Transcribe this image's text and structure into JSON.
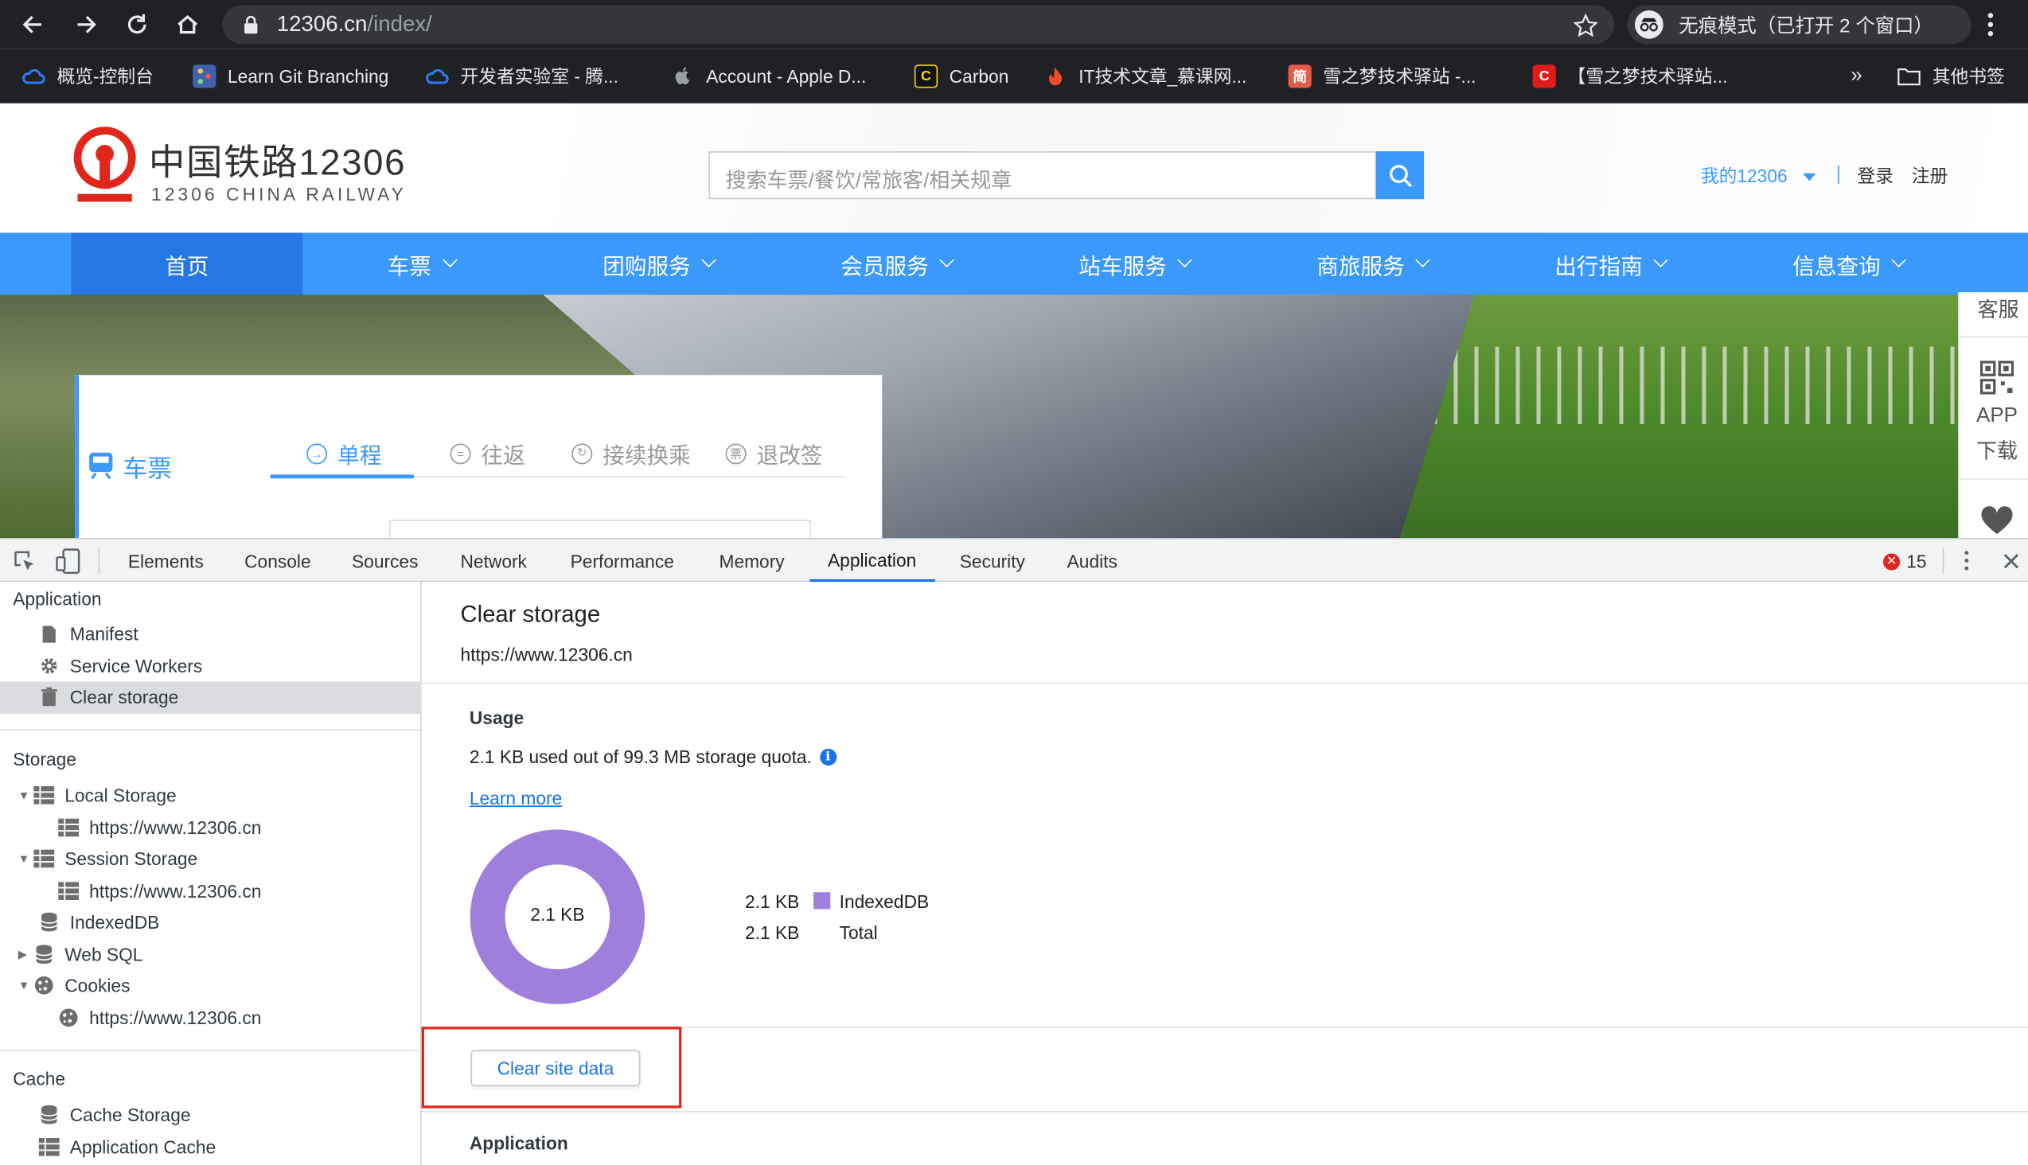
{
  "browser": {
    "url_host": "12306.cn",
    "url_path": "/index/",
    "incognito_label": "无痕模式（已打开 2 个窗口）",
    "bookmarks": [
      {
        "label": "概览-控制台",
        "icon": "cloud-icon",
        "color": "#2a7df7"
      },
      {
        "label": "Learn Git Branching",
        "icon": "git-branching-icon",
        "color": "#3f64ad"
      },
      {
        "label": "开发者实验室 - 腾...",
        "icon": "cloud-icon",
        "color": "#2a7df7"
      },
      {
        "label": "Account - Apple D...",
        "icon": "apple-icon",
        "color": "#9aa0a6"
      },
      {
        "label": "Carbon",
        "icon": "carbon-icon",
        "color": "#f5d90a"
      },
      {
        "label": "IT技术文章_慕课网...",
        "icon": "flame-icon",
        "color": "#f04c2b"
      },
      {
        "label": "雪之梦技术驿站 -...",
        "icon": "jian-icon",
        "color": "#e55b4a"
      },
      {
        "label": "【雪之梦技术驿站...",
        "icon": "csdn-icon",
        "color": "#e21b1b"
      }
    ],
    "overflow_label": "»",
    "other_bookmarks_label": "其他书签"
  },
  "site": {
    "logo_cn": "中国铁路12306",
    "logo_en": "12306 CHINA RAILWAY",
    "search_placeholder": "搜索车票/餐饮/常旅客/相关规章",
    "my12306": "我的12306",
    "login": "登录",
    "register": "注册",
    "nav": [
      "首页",
      "车票",
      "团购服务",
      "会员服务",
      "站车服务",
      "商旅服务",
      "出行指南",
      "信息查询"
    ],
    "ticket_title": "车票",
    "ticket_tabs": [
      "单程",
      "往返",
      "接续换乘",
      "退改签"
    ],
    "rail_service": "客服",
    "rail_app": "APP",
    "rail_download": "下载",
    "brand_color": "#3b99fc"
  },
  "devtools": {
    "tabs": [
      "Elements",
      "Console",
      "Sources",
      "Network",
      "Performance",
      "Memory",
      "Application",
      "Security",
      "Audits"
    ],
    "active_tab": "Application",
    "error_count": "15",
    "sidebar": {
      "application_header": "Application",
      "application_items": [
        "Manifest",
        "Service Workers",
        "Clear storage"
      ],
      "storage_header": "Storage",
      "local_storage": "Local Storage",
      "local_storage_origin": "https://www.12306.cn",
      "session_storage": "Session Storage",
      "session_storage_origin": "https://www.12306.cn",
      "indexeddb": "IndexedDB",
      "web_sql": "Web SQL",
      "cookies": "Cookies",
      "cookies_origin": "https://www.12306.cn",
      "cache_header": "Cache",
      "cache_storage": "Cache Storage",
      "application_cache": "Application Cache"
    },
    "main": {
      "title": "Clear storage",
      "origin": "https://www.12306.cn",
      "usage_header": "Usage",
      "usage_text": "2.1 KB used out of 99.3 MB storage quota.",
      "learn_more": "Learn more",
      "donut_label": "2.1 KB",
      "legend": [
        {
          "value": "2.1 KB",
          "name": "IndexedDB",
          "color": "#9e7fdc"
        },
        {
          "value": "2.1 KB",
          "name": "Total",
          "color": ""
        }
      ],
      "clear_button": "Clear site data",
      "application_header": "Application",
      "highlight_color": "#e1261c"
    }
  }
}
